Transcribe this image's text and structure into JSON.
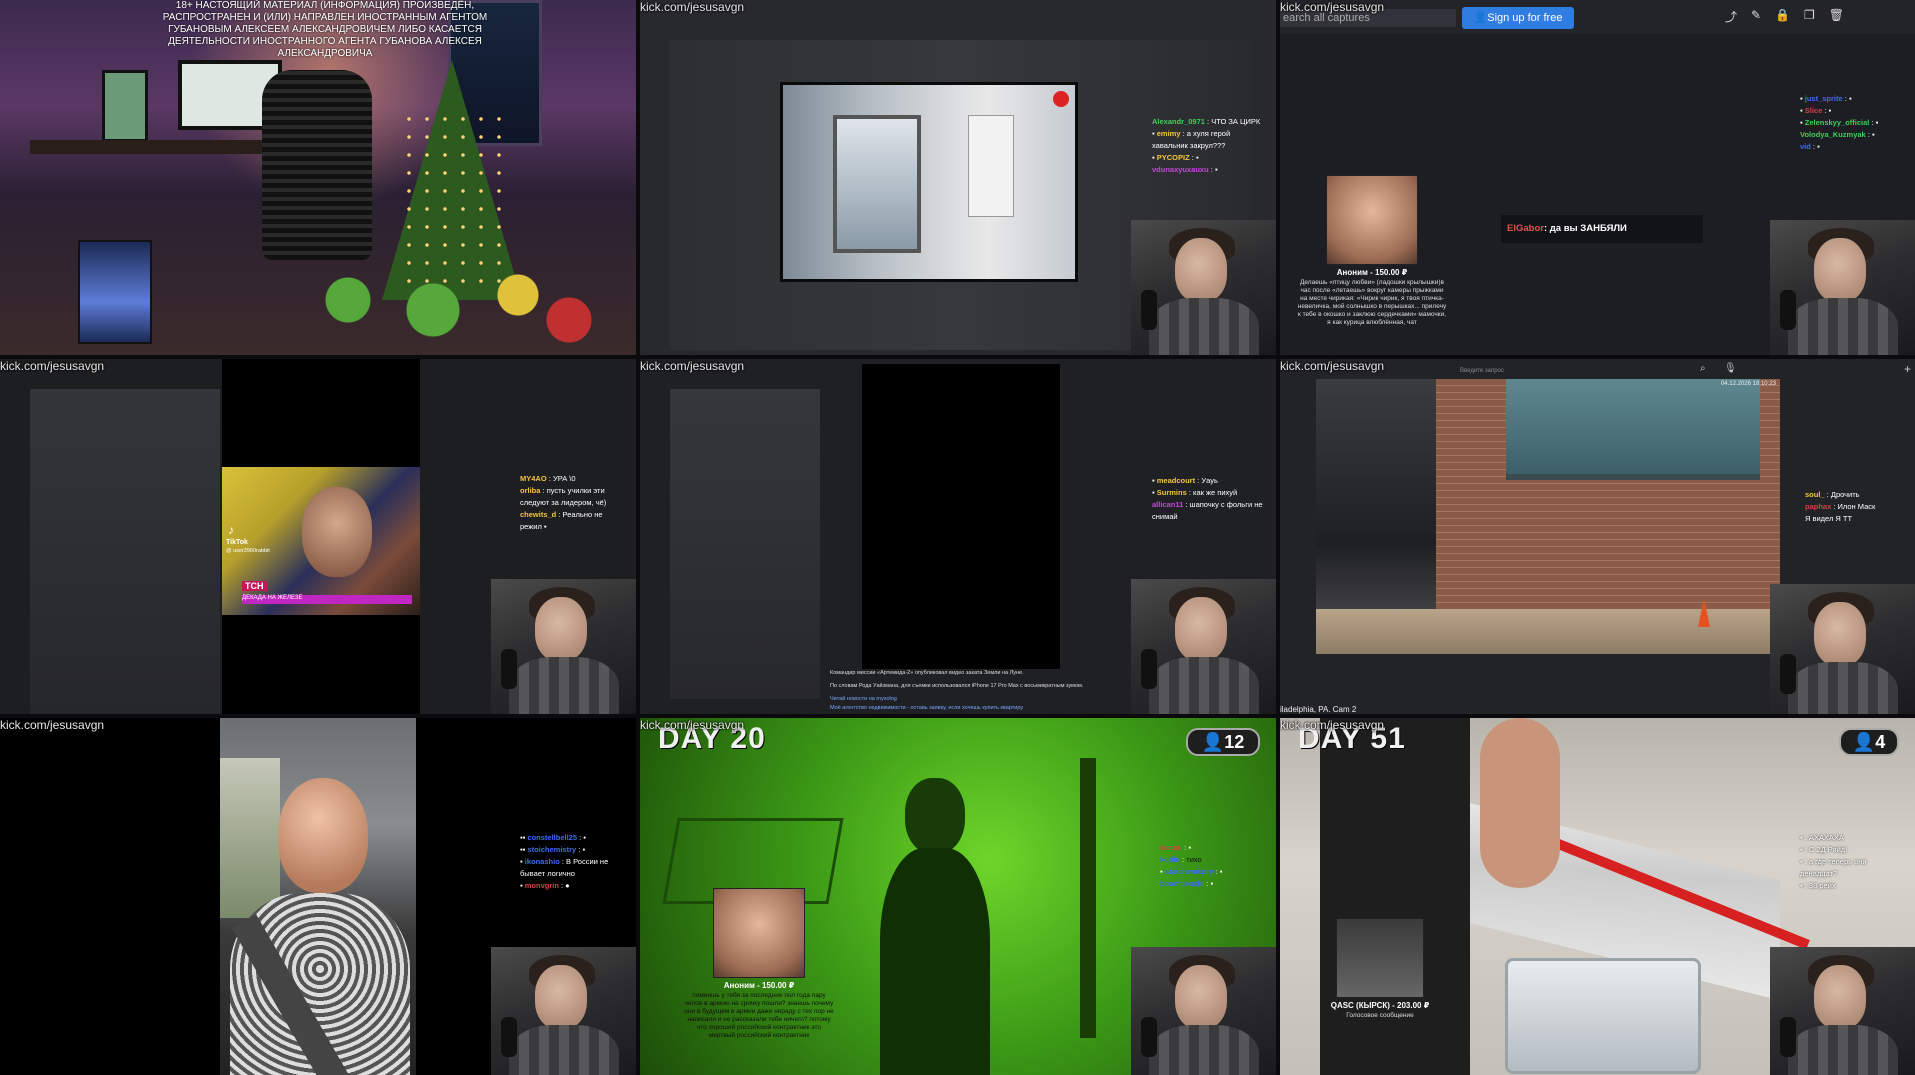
{
  "watermark": "kick.com/jesusavgn",
  "cell1": {
    "warning_text": "18+ НАСТОЯЩИЙ МАТЕРИАЛ (ИНФОРМАЦИЯ) ПРОИЗВЕДЁН, РАСПРОСТРАНЕН И (ИЛИ) НАПРАВЛЕН ИНОСТРАННЫМ АГЕНТОМ ГУБАНОВЫМ АЛЕКСЕЕМ АЛЕКСАНДРОВИЧЕМ ЛИБО КАСАЕТСЯ ДЕЯТЕЛЬНОСТИ ИНОСТРАННОГО АГЕНТА ГУБАНОВА АЛЕКСЕЯ АЛЕКСАНДРОВИЧА"
  },
  "cell2": {
    "chat": [
      {
        "user": "Alexandr_0971",
        "text": "ЧТО ЗА ЦИРК",
        "color": "#3fcf5a"
      },
      {
        "user": "emimy",
        "text": "а хуля герой",
        "color": "#f4c542"
      },
      {
        "user": "",
        "text": "хавальник закрул???",
        "color": "#f4c542"
      },
      {
        "user": "PYCOPIZ",
        "text": "",
        "color": "#f4c542"
      },
      {
        "user": "vdunaxyuxauxu",
        "text": "",
        "color": "#c24bd8"
      }
    ]
  },
  "cell3": {
    "search_placeholder": "earch all captures",
    "signup_label": "Sign up for free",
    "toolbar_icons": [
      "share-icon",
      "pencil-icon",
      "lock-icon",
      "copy-icon",
      "trash-icon"
    ],
    "chat": [
      {
        "user": "just_sprite",
        "color": "#3d6cf0"
      },
      {
        "user": "Slice",
        "color": "#d04545"
      },
      {
        "user": "Zelenskyy_official",
        "color": "#3fcf5a"
      },
      {
        "user": "Volodya_Kuzmyak",
        "color": "#3fcf5a"
      },
      {
        "user": "vid",
        "color": "#3d6cf0"
      }
    ],
    "alert_user": "ElGabor",
    "alert_text": ": да вы ЗАНБЯЛИ",
    "donation": {
      "amount": "Аноним - 150.00 ₽",
      "message": "Делаешь «птицу любви» (ладошки крылышки)в час после «летаешь» вокруг камеры прыжками на месте чирикая: «Чирик чирик, я твоя птичка-невеличка, мой солнышко в перышках... прилечу к тебе в окошко и заклюю сердечками» мамочки, я как курица влюблённая, чат"
    }
  },
  "cell4": {
    "tiktok_label": "TikTok",
    "tiktok_user": "@ user3960rabbit",
    "news_tag": "ТСН",
    "news_text": "ДЕКАДА НА ЖЕЛЕЗЕ",
    "chat": [
      {
        "user": "MY4AO",
        "text": "УРА \\0",
        "color": "#f4c542"
      },
      {
        "user": "orliba",
        "text": "пусть училки эти",
        "color": "#f4c542"
      },
      {
        "user": "",
        "text": "следуют за лидером, чё)",
        "color": "#f4c542"
      },
      {
        "user": "chewits_d",
        "text": "Реально не",
        "color": "#f4c542"
      },
      {
        "user": "",
        "text": "режил",
        "color": "#f4c542"
      }
    ]
  },
  "cell5": {
    "chat": [
      {
        "user": "meadcourt",
        "text": "Уауь",
        "color": "#f4c542"
      },
      {
        "user": "Surmins",
        "text": "как же пихуй",
        "color": "#f4c542"
      },
      {
        "user": "allican11",
        "text": "шапочку с фольги не",
        "color": "#c24bd8"
      },
      {
        "user": "",
        "text": "снимай",
        "color": "#ffffff"
      }
    ],
    "news_line_1": "Командир миссии «Артемида-2» опубликовал видео заката Земли на Луне.",
    "news_line_2": "По словам Рода Уайзмана, для съемки использовался iPhone 17 Pro Max с восьмикратным зумом.",
    "news_line_3": "Читай новости на mysolog",
    "news_line_4": "Моё агентство недвижимости - оставь заявку, если хочешь купить квартиру"
  },
  "cell6": {
    "search_placeholder": "Введите запрос",
    "timestamp": "04.12.2026 18:10:23",
    "location": "iladelphia, PA. Cam 2",
    "chat": [
      {
        "user": "soul_",
        "text": "Дрочить",
        "color": "#f4c542"
      },
      {
        "user": "paphax",
        "text": "Илон Маск",
        "color": "#d04545"
      },
      {
        "user": "",
        "text": "Я видел Я ТТ",
        "color": "#ffffff"
      }
    ]
  },
  "cell7": {
    "chat": [
      {
        "user": "constellbell25",
        "text": "",
        "color": "#3d6cf0"
      },
      {
        "user": "stoichemistry",
        "text": "",
        "color": "#3d6cf0"
      },
      {
        "user": "ikonashio",
        "text": "В России не",
        "color": "#3d6cf0"
      },
      {
        "user": "",
        "text": "бывает логично",
        "color": "#ffffff"
      },
      {
        "user": "monvgrin",
        "text": "",
        "color": "#d04545"
      }
    ]
  },
  "cell8": {
    "day": "DAY 20",
    "viewers": "12",
    "donation": {
      "amount": "Аноним - 150.00 ₽",
      "message": "помнишь у тебя за последние пол года пару челов в армию на срочку пошли? знаешь почему они в будущем в армии даже нераду с тех пор не написали и не рассказали тебе ничего? потому что хороший российский контрактник это мертвый российский контрактник"
    },
    "chat": [
      {
        "user": "kimbo",
        "text": "",
        "color": "#d04545"
      },
      {
        "user": "kotlin",
        "text": "тихо",
        "color": "#3d6cf0"
      },
      {
        "user": "stoichemistry",
        "text": "",
        "color": "#3d6cf0"
      },
      {
        "user": "boombeachi",
        "text": "",
        "color": "#3d6cf0"
      }
    ]
  },
  "cell9": {
    "day": "DAY 51",
    "viewers": "4",
    "donation": {
      "amount": "QASC (КЫРСК) - 203.00 ₽",
      "message": "Голосовое сообщение"
    },
    "chat": [
      {
        "user": "",
        "text": "АХАХАХА",
        "color": "#ffffff"
      },
      {
        "user": "",
        "text": "С 2Д Ряйд!",
        "color": "#ffffff"
      },
      {
        "user": "",
        "text": "а где теперь они",
        "color": "#ffffff"
      },
      {
        "user": "",
        "text": "денадцат?",
        "color": "#ffffff"
      },
      {
        "user": "",
        "text": "38 рейх",
        "color": "#ffffff"
      }
    ]
  }
}
